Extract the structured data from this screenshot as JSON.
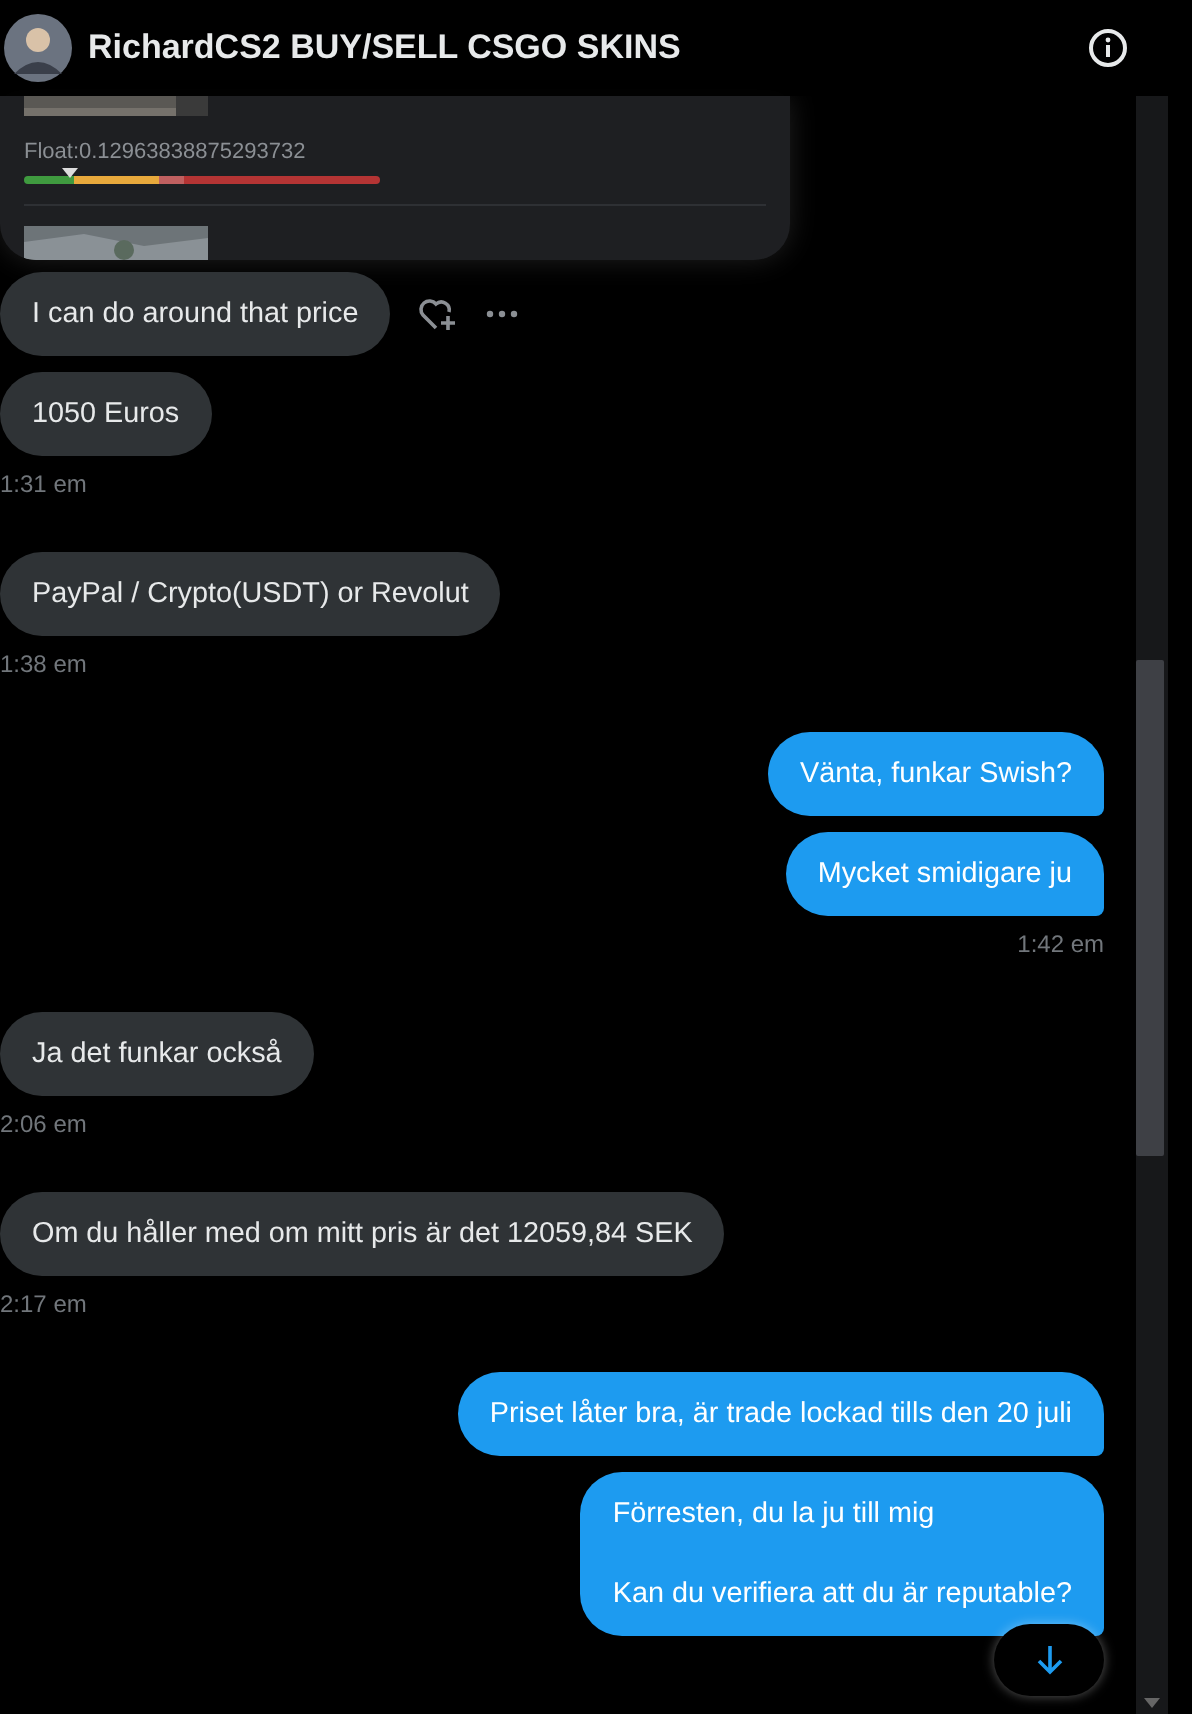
{
  "header": {
    "title": "RichardCS2 BUY/SELL CSGO SKINS"
  },
  "product_card": {
    "float_label": "Float:0.12963838875293732",
    "level": 0.13
  },
  "messages": [
    {
      "kind": "received",
      "text": "I can do around that price",
      "hovered": true
    },
    {
      "kind": "received",
      "text": "1050 Euros",
      "hovered": false,
      "time": "1:31 em"
    },
    {
      "kind": "received",
      "text": "PayPal / Crypto(USDT) or Revolut",
      "hovered": false,
      "time": "1:38 em"
    },
    {
      "kind": "sent",
      "text": "Vänta, funkar Swish?",
      "hovered": false
    },
    {
      "kind": "sent",
      "text": "Mycket smidigare ju",
      "hovered": false,
      "time": "1:42 em"
    },
    {
      "kind": "received",
      "text": "Ja det funkar också",
      "hovered": false,
      "time": "2:06 em"
    },
    {
      "kind": "received",
      "text": "Om du håller med om mitt pris är det 12059,84 SEK",
      "hovered": false,
      "time": "2:17 em"
    },
    {
      "kind": "sent",
      "text": "Priset låter bra, är trade lockad tills den 20 juli",
      "hovered": false
    },
    {
      "kind": "sent",
      "text": "Förresten, du la ju till mig\n\nKan du verifiera att du är reputable?",
      "hovered": false
    }
  ]
}
